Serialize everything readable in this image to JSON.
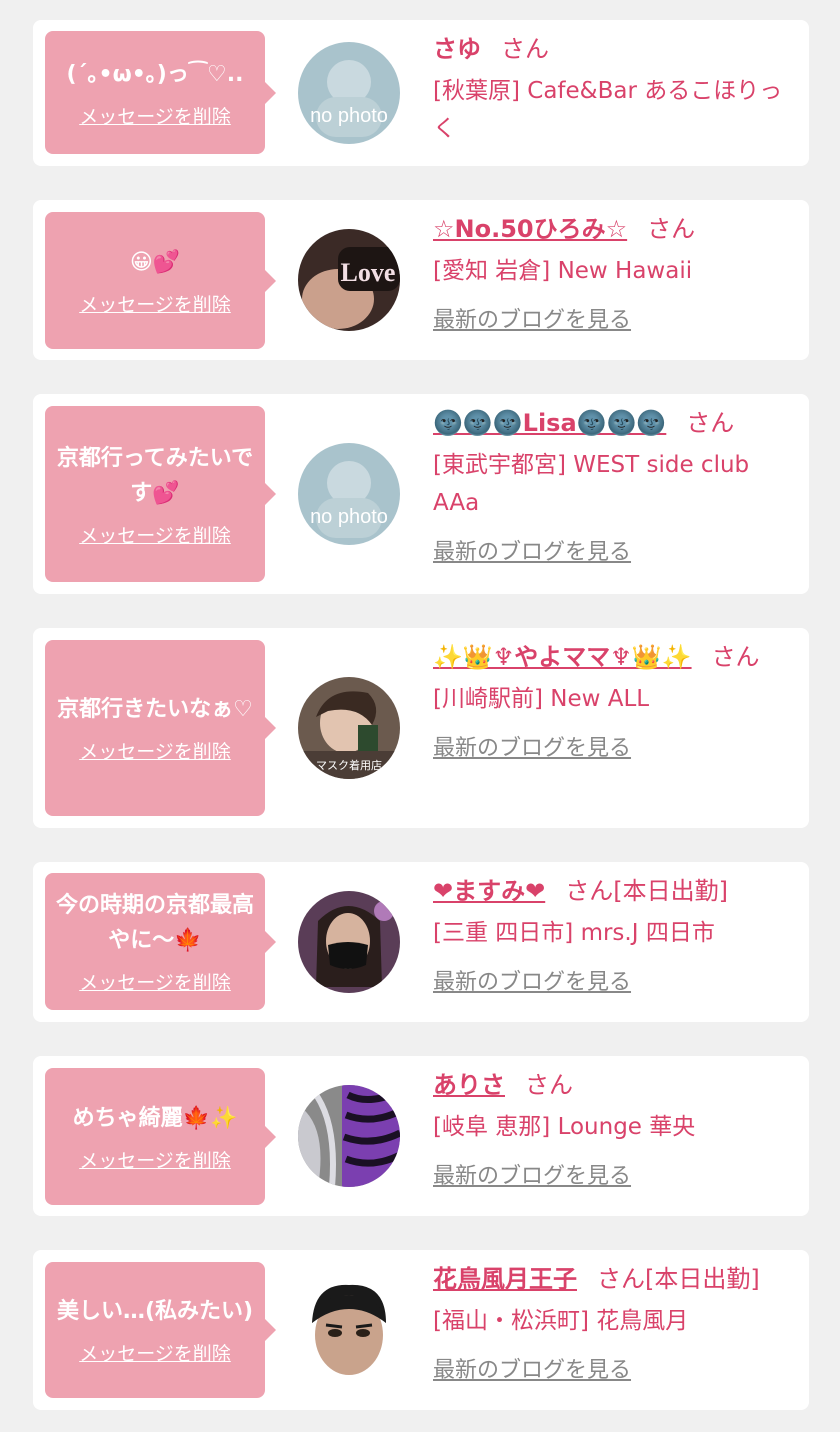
{
  "delete_label": "メッセージを削除",
  "blog_label": "最新のブログを見る",
  "colors": {
    "bubble": "#eea2b0",
    "accent": "#d9426a",
    "link_gray": "#888888",
    "background": "#f0f0f0"
  },
  "cards": [
    {
      "message": "(´｡•ω•｡)っ⁀♡..",
      "avatar": "no-photo",
      "avatar_text": "no photo",
      "name": "さゆ",
      "name_linked": false,
      "suffix": "さん",
      "shop": "[秋葉原] Cafe&Bar あるこほりっく",
      "show_blog": false
    },
    {
      "message": "😀💕",
      "avatar": "love-photo",
      "avatar_text": "Love",
      "name": "☆No.50ひろみ☆",
      "name_linked": true,
      "suffix": "さん",
      "shop": "[愛知 岩倉] New Hawaii",
      "show_blog": true
    },
    {
      "message": "京都行ってみたいです💕",
      "avatar": "no-photo",
      "avatar_text": "no photo",
      "name": "🌚🌚🌚Lisa🌚🌚🌚",
      "name_linked": true,
      "suffix": "さん",
      "shop": "[東武宇都宮] WEST side club AAa",
      "show_blog": true
    },
    {
      "message": "京都行きたいなぁ♡",
      "avatar": "portrait-woman",
      "avatar_text": "マスク着用店",
      "name": "✨👑♆やよママ♆👑✨",
      "name_linked": true,
      "suffix": "さん",
      "shop": "[川崎駅前] New ALL",
      "show_blog": true
    },
    {
      "message": "今の時期の京都最高やに〜🍁",
      "avatar": "portrait-mask",
      "avatar_text": "",
      "name": "❤ますみ❤",
      "name_linked": true,
      "suffix": "さん[本日出勤]",
      "shop": "[三重 四日市] mrs.J 四日市",
      "show_blog": true
    },
    {
      "message": "めちゃ綺麗🍁✨",
      "avatar": "zebra-photo",
      "avatar_text": "",
      "name": "ありさ",
      "name_linked": true,
      "suffix": "さん",
      "shop": "[岐阜 恵那] Lounge 華央",
      "show_blog": true
    },
    {
      "message": "美しい…(私みたい)",
      "avatar": "man-face",
      "avatar_text": "",
      "name": "花鳥風月王子",
      "name_linked": true,
      "suffix": "さん[本日出勤]",
      "shop": "[福山・松浜町] 花鳥風月",
      "show_blog": true
    }
  ]
}
